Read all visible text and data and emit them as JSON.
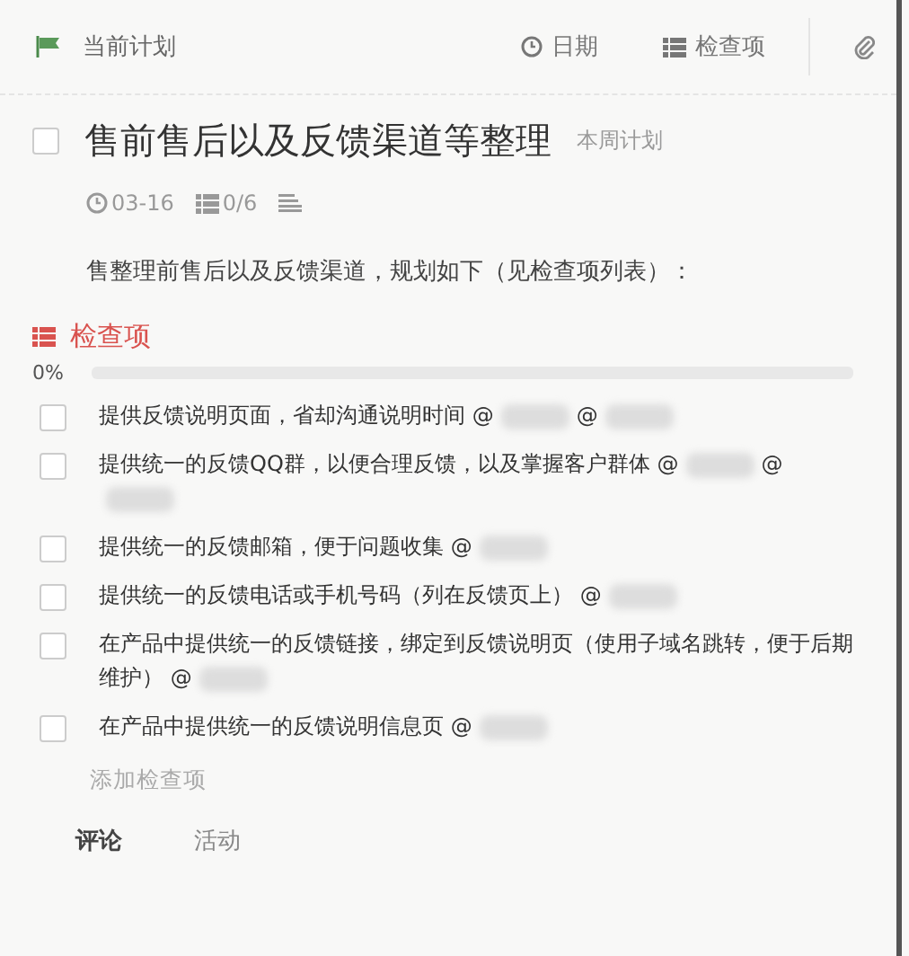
{
  "toolbar": {
    "plan": "当前计划",
    "actions": [
      {
        "kind": "date",
        "label": "日期"
      },
      {
        "kind": "checklist",
        "label": "检查项"
      },
      {
        "kind": "attach"
      }
    ]
  },
  "task": {
    "checked": false,
    "title": "售前售后以及反馈渠道等整理",
    "tag": "本周计划",
    "due": "03-16",
    "progress": "0/6",
    "description": "售整理前售后以及反馈渠道，规划如下（见检查项列表）："
  },
  "checklist": {
    "title": "检查项",
    "percent": "0%",
    "level": 0,
    "items": [
      {
        "checked": false,
        "parts": [
          "提供反馈说明页面，省却沟通说明时间 @",
          "@"
        ]
      },
      {
        "checked": false,
        "parts": [
          "提供统一的反馈QQ群，以便合理反馈，以及掌握客户群体 @",
          "@"
        ]
      },
      {
        "checked": false,
        "parts": [
          "提供统一的反馈邮箱，便于问题收集 @"
        ]
      },
      {
        "checked": false,
        "parts": [
          "提供统一的反馈电话或手机号码（列在反馈页上） @"
        ]
      },
      {
        "checked": false,
        "parts": [
          "在产品中提供统一的反馈链接，绑定到反馈说明页（使用子域名跳转，便于后期维护） @"
        ]
      },
      {
        "checked": false,
        "parts": [
          "在产品中提供统一的反馈说明信息页 @"
        ]
      }
    ],
    "add": "添加检查项"
  },
  "tabs": [
    {
      "label": "评论",
      "selected": true
    },
    {
      "label": "活动",
      "selected": false
    }
  ]
}
